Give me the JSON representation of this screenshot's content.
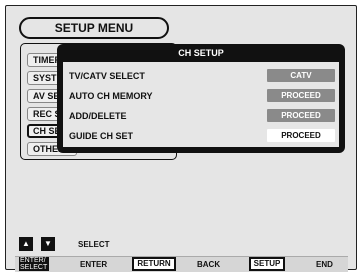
{
  "setup_menu": {
    "title": "SETUP MENU",
    "items": [
      "TIMER",
      "SYSTEM",
      "AV SETUP",
      "REC SETUP",
      "CH SETUP",
      "OTHERS"
    ]
  },
  "ch_setup": {
    "title": "CH SETUP",
    "rows": [
      {
        "label": "TV/CATV SELECT",
        "value": "CATV"
      },
      {
        "label": "AUTO CH MEMORY",
        "value": "PROCEED"
      },
      {
        "label": "ADD/DELETE",
        "value": "PROCEED"
      },
      {
        "label": "GUIDE CH SET",
        "value": "PROCEED"
      }
    ]
  },
  "footer": {
    "select_label": "SELECT",
    "enter_key_line1": "ENTER/",
    "enter_key_line2": "SELECT",
    "enter_label": "ENTER",
    "return_key": "RETURN",
    "back_label": "BACK",
    "setup_key": "SETUP",
    "end_label": "END"
  }
}
